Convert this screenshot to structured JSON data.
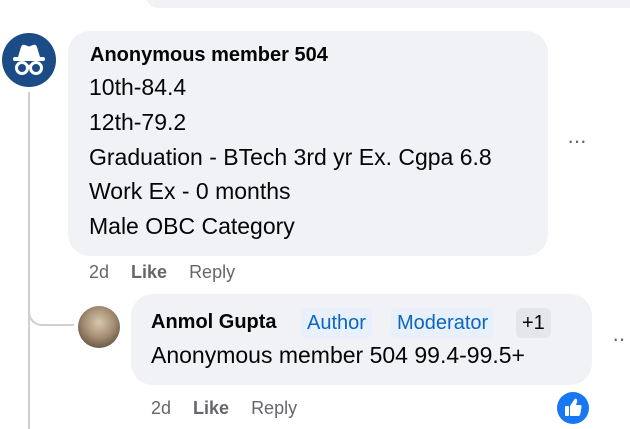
{
  "comment": {
    "author": "Anonymous member 504",
    "lines": [
      "10th-84.4",
      "12th-79.2",
      "Graduation - BTech 3rd yr Ex. Cgpa 6.8",
      "Work Ex - 0 months",
      "Male OBC Category"
    ],
    "time": "2d",
    "like_label": "Like",
    "reply_label": "Reply",
    "more": "···"
  },
  "reply": {
    "author": "Anmol Gupta",
    "badges": [
      "Author",
      "Moderator"
    ],
    "extra_badge": "+1",
    "text": "Anonymous member 504 99.4-99.5+",
    "time": "2d",
    "like_label": "Like",
    "reply_label": "Reply",
    "more": "··"
  },
  "icons": {
    "anonymous_avatar": "incognito-icon",
    "reaction": "thumbs-up-icon"
  },
  "colors": {
    "bubble": "#f0f2f5",
    "anon_avatar": "#1b4c86",
    "badge_text": "#0a66c2",
    "reaction": "#1877f2"
  }
}
